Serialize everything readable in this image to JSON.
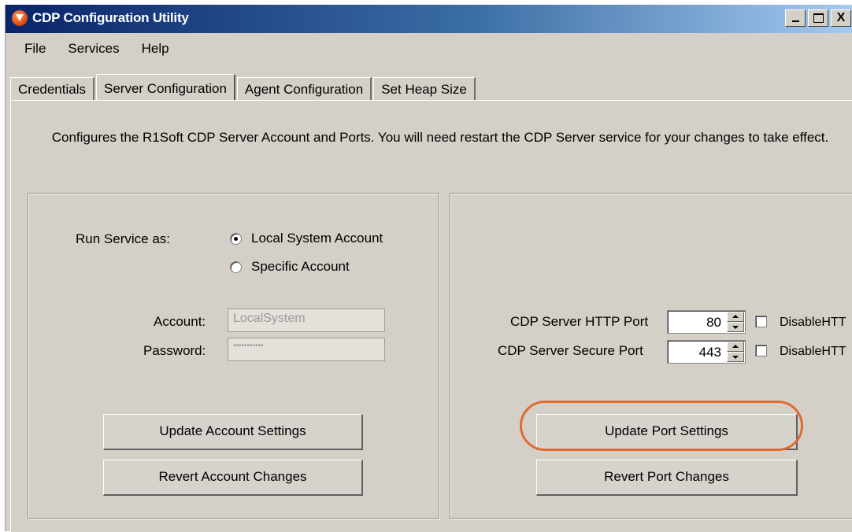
{
  "window": {
    "title": "CDP Configuration Utility",
    "controls": {
      "minimize": "_",
      "maximize": "□",
      "close": "X"
    }
  },
  "menu": [
    "File",
    "Services",
    "Help"
  ],
  "tabs": [
    {
      "label": "Credentials",
      "active": false
    },
    {
      "label": "Server Configuration",
      "active": true
    },
    {
      "label": "Agent Configuration",
      "active": false
    },
    {
      "label": "Set Heap Size",
      "active": false
    }
  ],
  "description": "Configures the R1Soft CDP Server Account and Ports. You will need restart the CDP Server service for your changes to take effect.",
  "account_panel": {
    "run_service_label": "Run Service as:",
    "options": [
      {
        "label": "Local System Account",
        "selected": true
      },
      {
        "label": "Specific Account",
        "selected": false
      }
    ],
    "account_label": "Account:",
    "account_value": "LocalSystem",
    "password_label": "Password:",
    "password_value": "•••••••••••",
    "update_button": "Update Account Settings",
    "revert_button": "Revert Account Changes"
  },
  "port_panel": {
    "http_port_label": "CDP Server HTTP Port",
    "http_port_value": "80",
    "secure_port_label": "CDP Server Secure Port",
    "secure_port_value": "443",
    "disable_http_label": "DisableHTT",
    "disable_https_label": "DisableHTT",
    "update_button": "Update Port Settings",
    "revert_button": "Revert Port Changes"
  },
  "colors": {
    "titlebar_start": "#0a246a",
    "titlebar_end": "#a6caf0",
    "dialog_bg": "#d4d0c8",
    "highlight": "#e06a30"
  }
}
